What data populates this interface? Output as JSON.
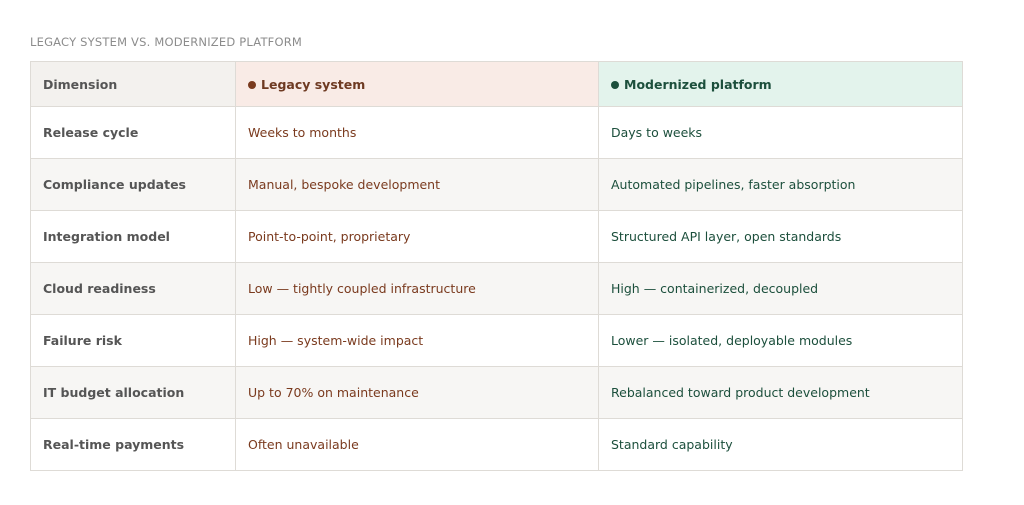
{
  "caption": "LEGACY SYSTEM VS. MODERNIZED PLATFORM",
  "colors": {
    "legacy_accent": "#7a3a1e",
    "modern_accent": "#1c4f3c",
    "legacy_header_bg": "#f9ebe6",
    "modern_header_bg": "#e3f3ec"
  },
  "table": {
    "headers": {
      "dimension": "Dimension",
      "legacy": "Legacy system",
      "modern": "Modernized platform"
    },
    "rows": [
      {
        "dimension": "Release cycle",
        "legacy": "Weeks to months",
        "modern": "Days to weeks"
      },
      {
        "dimension": "Compliance updates",
        "legacy": "Manual, bespoke development",
        "modern": "Automated pipelines, faster absorption"
      },
      {
        "dimension": "Integration model",
        "legacy": "Point-to-point, proprietary",
        "modern": "Structured API layer, open standards"
      },
      {
        "dimension": "Cloud readiness",
        "legacy": "Low — tightly coupled infrastructure",
        "modern": "High — containerized, decoupled"
      },
      {
        "dimension": "Failure risk",
        "legacy": "High — system-wide impact",
        "modern": "Lower — isolated, deployable modules"
      },
      {
        "dimension": "IT budget allocation",
        "legacy": "Up to 70% on maintenance",
        "modern": "Rebalanced toward product development"
      },
      {
        "dimension": "Real-time payments",
        "legacy": "Often unavailable",
        "modern": "Standard capability"
      }
    ]
  }
}
